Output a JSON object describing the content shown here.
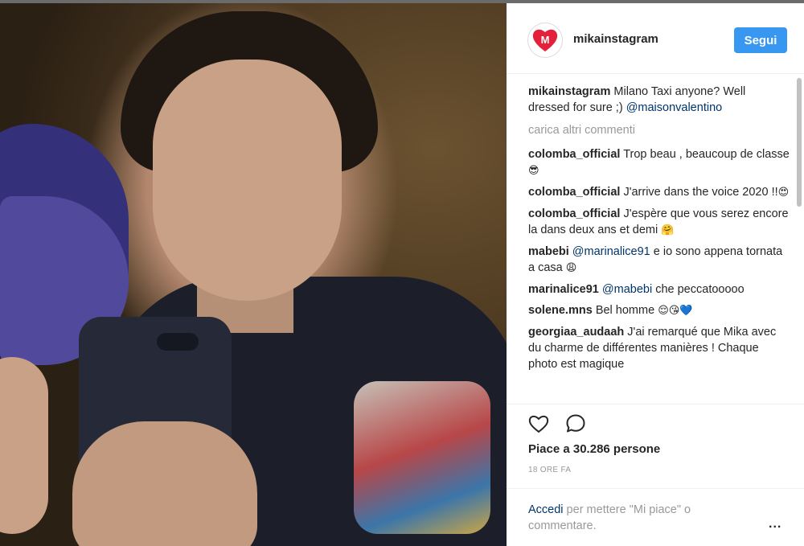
{
  "post": {
    "username": "mikainstagram",
    "follow_label": "Segui",
    "caption_user": "mikainstagram",
    "caption_text": "Milano Taxi anyone? Well dressed for sure ;) ",
    "caption_mention": "@maisonvalentino",
    "load_more": "carica altri commenti",
    "likes": "Piace a 30.286 persone",
    "time": "18 ORE FA",
    "login_link": "Accedi",
    "login_text": " per mettere \"Mi piace\" o commentare.",
    "more": "..."
  },
  "comments": [
    {
      "user": "colomba_official",
      "text": "Trop beau , beaucoup de classe ",
      "emoji": "😎"
    },
    {
      "user": "colomba_official",
      "text": "J'arrive dans the voice 2020 !!",
      "emoji": "😍"
    },
    {
      "user": "colomba_official",
      "text": "J'espère que vous serez encore la dans deux ans et demi ",
      "emoji": "🤗"
    },
    {
      "user": "mabebi",
      "mention": "@marinalice91",
      "text": " e io sono appena tornata a casa ",
      "emoji": "😩"
    },
    {
      "user": "marinalice91",
      "mention": "@mabebi",
      "text": " che peccatooooo",
      "emoji": ""
    },
    {
      "user": "solene.mns",
      "text": "Bel homme ",
      "emoji": "😌😘💙"
    },
    {
      "user": "georgiaa_audaah",
      "text": "J'ai remarqué que Mika avec du charme de différentes manières ! Chaque photo est magique",
      "emoji": ""
    }
  ],
  "icons": {
    "avatar": "heart-m-logo-icon",
    "like": "heart-outline-icon",
    "comment": "speech-bubble-icon",
    "more": "more-options-icon"
  },
  "colors": {
    "accent": "#3897f0",
    "link": "#003569",
    "brand_red": "#e5203a"
  }
}
